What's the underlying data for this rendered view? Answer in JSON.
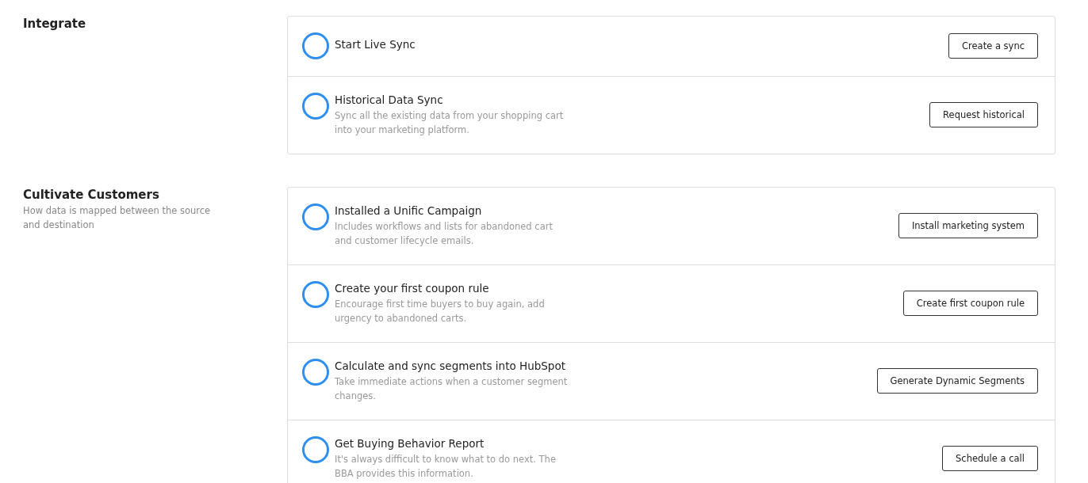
{
  "sections": [
    {
      "title": "Integrate",
      "tasks": [
        {
          "title": "Start Live Sync",
          "completed": false,
          "button": "Create a sync"
        },
        {
          "title": "Historical Data Sync",
          "description": "Sync all the existing data from your shopping cart into your marketing platform.",
          "completed": false,
          "button": "Request historical"
        }
      ]
    },
    {
      "title": "Cultivate Customers",
      "description": "How data is mapped between the source and destination",
      "tasks": [
        {
          "title": "Installed a Unific Campaign",
          "description": "Includes workflows and lists for abandoned cart and customer lifecycle emails.",
          "completed": false,
          "button": "Install marketing system"
        },
        {
          "title": "Create your first coupon rule",
          "description": "Encourage first time buyers to buy again, add urgency to abandoned carts.",
          "completed": false,
          "button": "Create first coupon rule"
        },
        {
          "title": "Calculate and sync segments into HubSpot",
          "description": "Take immediate actions when a customer segment changes.",
          "completed": false,
          "button": "Generate Dynamic Segments"
        },
        {
          "title": "Get Buying Behavior Report",
          "description": "It's always difficult to know what to do next. The BBA provides this information.",
          "completed": false,
          "button": "Schedule a call"
        }
      ]
    }
  ]
}
